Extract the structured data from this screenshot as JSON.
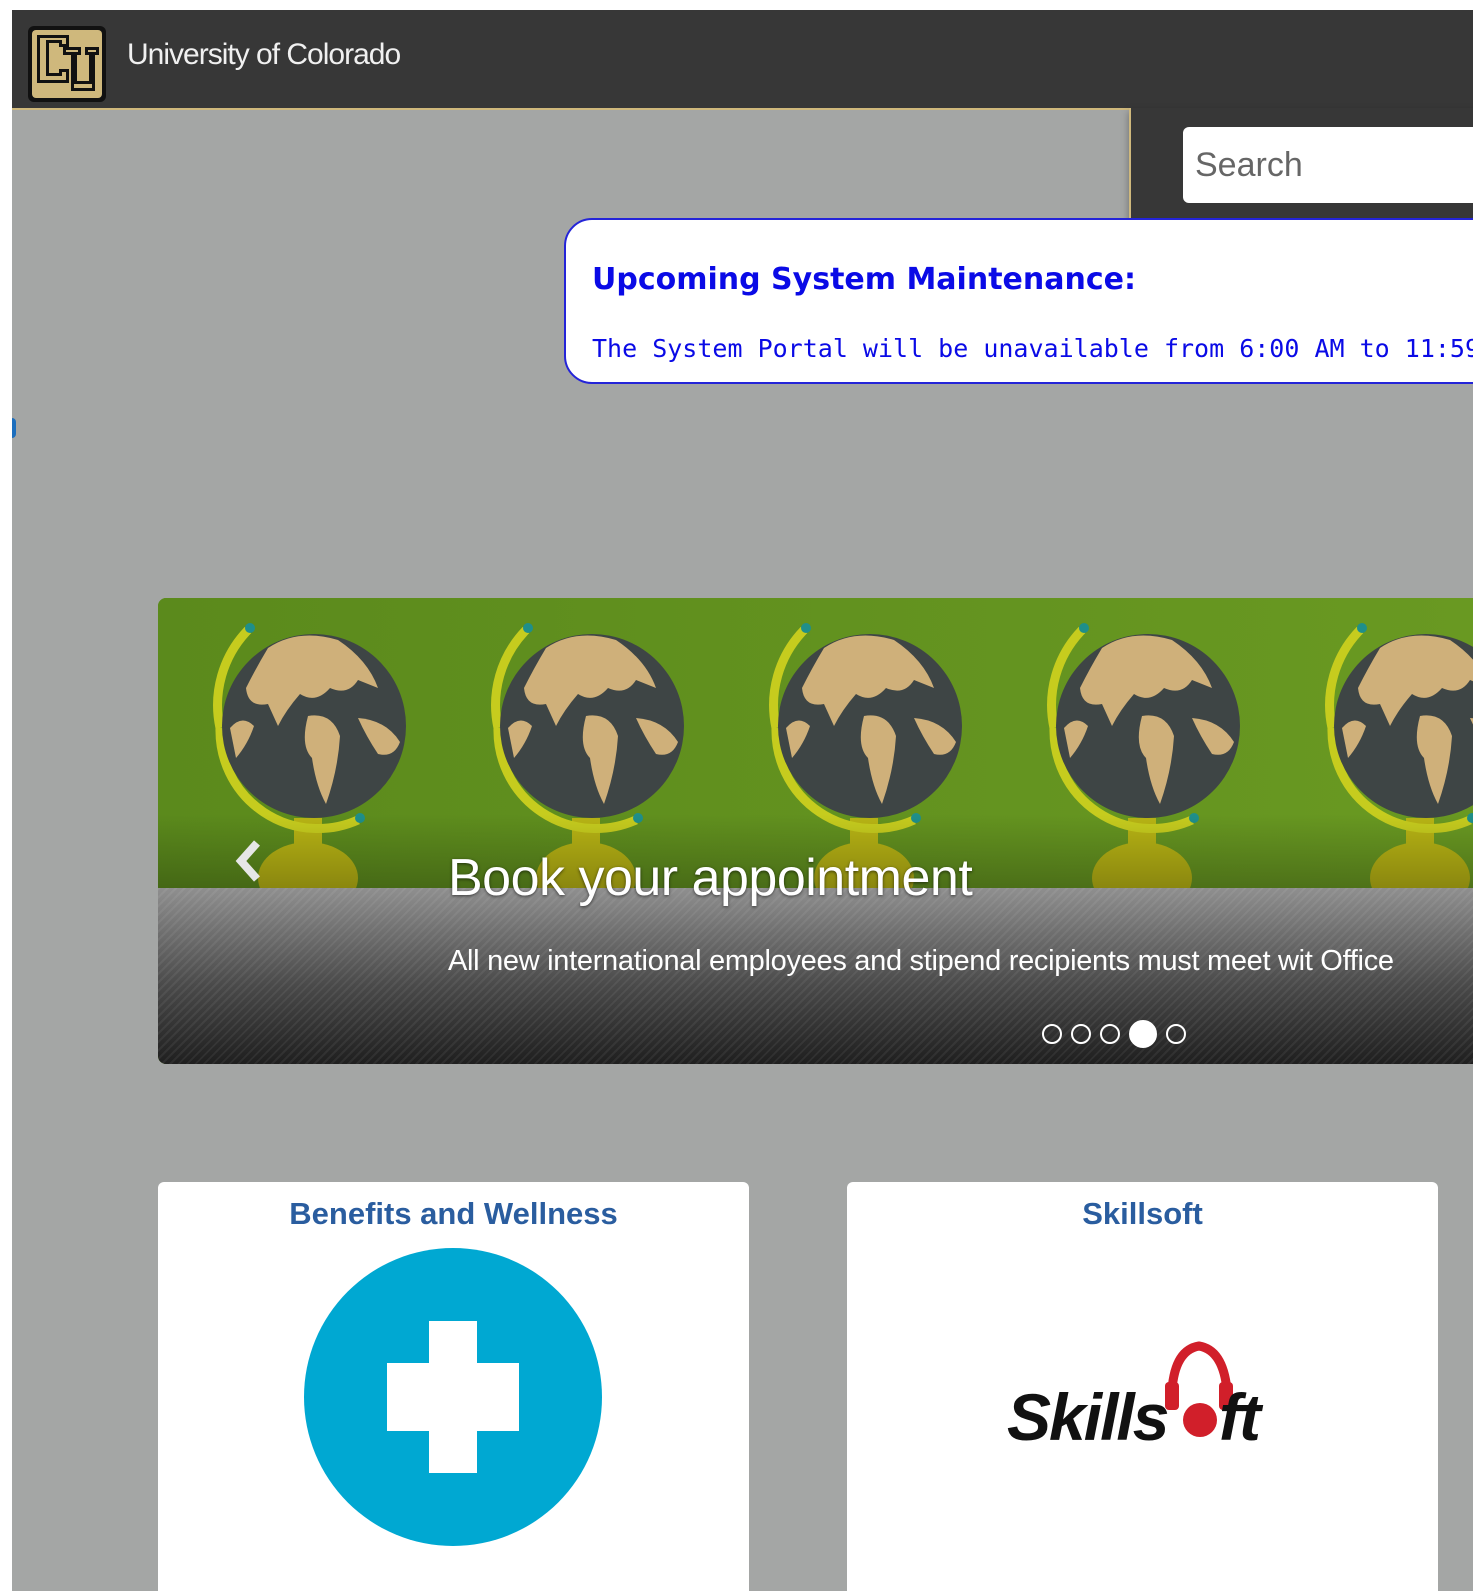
{
  "header": {
    "site_title": "University of Colorado",
    "accent_color": "#cfb87c",
    "bar_color": "#373737"
  },
  "search": {
    "placeholder": "Search",
    "value": ""
  },
  "notice": {
    "title": "Upcoming System Maintenance:",
    "text": "The System Portal will be unavailable from 6:00 AM to 11:59",
    "color": "#0a0ae6"
  },
  "carousel": {
    "slide_title": "Book your appointment",
    "slide_description": "All new international employees and stipend recipients must meet wit Office",
    "indicator_count": 5,
    "active_indicator": 4,
    "prev_icon": "chevron-left-icon"
  },
  "tiles": [
    {
      "title": "Benefits and Wellness",
      "icon": "medical-cross-icon",
      "icon_color": "#00a8d2"
    },
    {
      "title": "Skillsoft",
      "icon": "skillsoft-logo"
    }
  ]
}
